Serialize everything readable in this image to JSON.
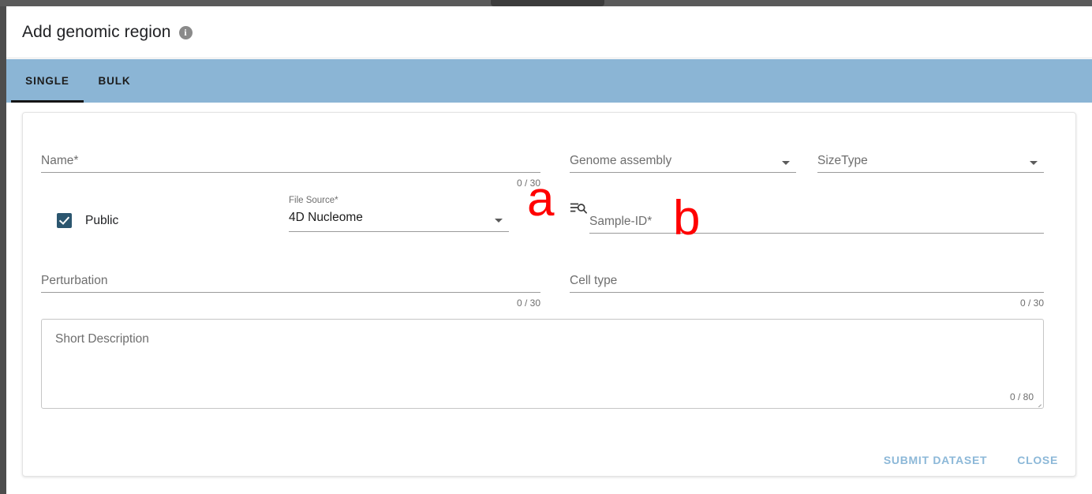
{
  "window": {
    "title": "Add genomic region",
    "info_icon": "info-icon"
  },
  "tabs": [
    {
      "label": "SINGLE",
      "active": true
    },
    {
      "label": "BULK",
      "active": false
    }
  ],
  "form": {
    "name": {
      "label": "Name",
      "required": "*",
      "value": "",
      "counter": "0 / 30"
    },
    "genome_assembly": {
      "label": "Genome assembly",
      "value": "",
      "caret": "chevron-down-icon"
    },
    "size_type": {
      "label": "SizeType",
      "value": "",
      "caret": "chevron-down-icon"
    },
    "public": {
      "label": "Public",
      "checked": true
    },
    "file_source": {
      "label": "File Source",
      "required": "*",
      "value": "4D Nucleome",
      "caret": "chevron-down-icon"
    },
    "manage_search": {
      "icon": "manage-search-icon"
    },
    "sample_id": {
      "label": "Sample-ID",
      "required": "*",
      "value": ""
    },
    "perturbation": {
      "label": "Perturbation",
      "value": "",
      "counter": "0 / 30"
    },
    "cell_type": {
      "label": "Cell type",
      "value": "",
      "counter": "0 / 30"
    },
    "short_description": {
      "placeholder": "Short Description",
      "value": "",
      "counter": "0 / 80"
    }
  },
  "actions": {
    "submit_label": "SUBMIT DATASET",
    "close_label": "CLOSE"
  },
  "annotations": [
    {
      "text": "a"
    },
    {
      "text": "b"
    }
  ],
  "colors": {
    "tabbar": "#8bb5d5",
    "checkbox": "#2b566f",
    "action": "#8cb8d8",
    "annotation": "#ff0000"
  }
}
